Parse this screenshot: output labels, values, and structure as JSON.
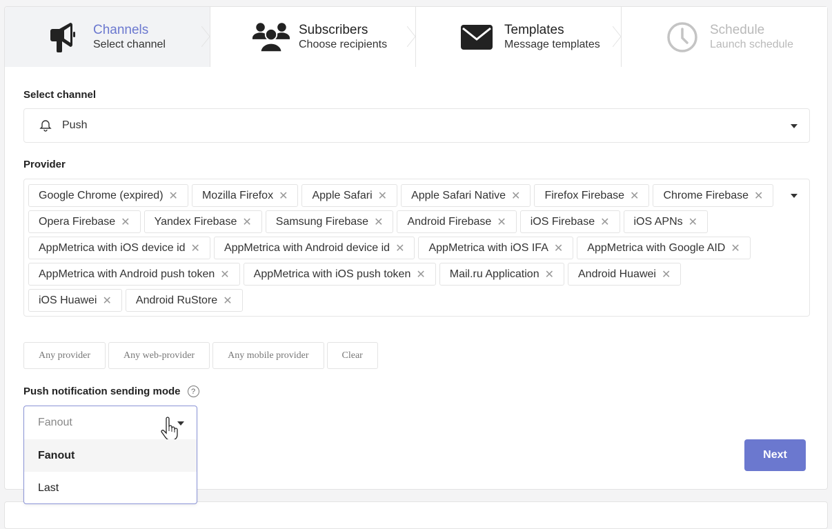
{
  "steps": [
    {
      "title": "Channels",
      "subtitle": "Select channel",
      "icon": "megaphone-icon",
      "state": "active"
    },
    {
      "title": "Subscribers",
      "subtitle": "Choose recipients",
      "icon": "users-icon",
      "state": "enabled"
    },
    {
      "title": "Templates",
      "subtitle": "Message templates",
      "icon": "envelope-icon",
      "state": "enabled"
    },
    {
      "title": "Schedule",
      "subtitle": "Launch schedule",
      "icon": "clock-icon",
      "state": "disabled"
    }
  ],
  "channel": {
    "label": "Select channel",
    "value": "Push",
    "icon": "bell-icon"
  },
  "provider": {
    "label": "Provider",
    "tags": [
      "Google Chrome (expired)",
      "Mozilla Firefox",
      "Apple Safari",
      "Apple Safari Native",
      "Firefox Firebase",
      "Chrome Firebase",
      "Opera Firebase",
      "Yandex Firebase",
      "Samsung Firebase",
      "Android Firebase",
      "iOS Firebase",
      "iOS APNs",
      "AppMetrica with iOS device id",
      "AppMetrica with Android device id",
      "AppMetrica with iOS IFA",
      "AppMetrica with Google AID",
      "AppMetrica with Android push token",
      "AppMetrica with iOS push token",
      "Mail.ru Application",
      "Android Huawei",
      "iOS Huawei",
      "Android RuStore"
    ],
    "remove_glyph": "✕"
  },
  "quick_buttons": [
    "Any provider",
    "Any web-provider",
    "Any mobile provider",
    "Clear"
  ],
  "mode": {
    "label": "Push notification sending mode",
    "help_glyph": "?",
    "current": "Fanout",
    "options": [
      "Fanout",
      "Last"
    ],
    "selected": "Fanout"
  },
  "actions": {
    "next_label": "Next"
  },
  "colors": {
    "accent": "#6b78cf",
    "active_step_bg": "#f2f3f5",
    "disabled_text": "#b9b9b9"
  }
}
